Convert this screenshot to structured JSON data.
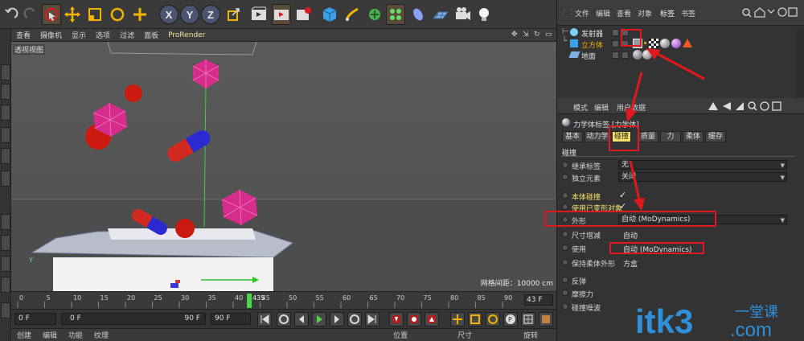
{
  "viewport": {
    "menu": [
      "查看",
      "摄像机",
      "显示",
      "选项",
      "过滤",
      "面板",
      "ProRender"
    ],
    "label": "透视视图",
    "grid_label": "网格间距：10000 cm"
  },
  "timeline": {
    "ticks": [
      "0",
      "5",
      "10",
      "15",
      "20",
      "25",
      "30",
      "35",
      "40",
      "45",
      "50",
      "55",
      "60",
      "65",
      "70",
      "75",
      "80",
      "85",
      "90"
    ],
    "marker": "435",
    "current_frame": "43 F"
  },
  "playback": {
    "start": "0 F",
    "range_start": "0 F",
    "range_end": "90 F",
    "end": "90 F"
  },
  "bottom_bar": {
    "left": [
      "创建",
      "编辑",
      "功能",
      "纹理"
    ],
    "right": [
      "位置",
      "尺寸",
      "旋转"
    ]
  },
  "object_manager": {
    "menu": [
      "文件",
      "编辑",
      "查看",
      "对象",
      "标签",
      "书签"
    ],
    "active_menu": "标签",
    "objects": [
      {
        "name": "发射器"
      },
      {
        "name": "立方体"
      },
      {
        "name": "地面"
      }
    ]
  },
  "attribute_manager": {
    "menu": [
      "模式",
      "编辑",
      "用户数据"
    ],
    "title": "力学体标签 [力学体]",
    "tabs": [
      "基本",
      "动力学",
      "碰撞",
      "质量",
      "力",
      "柔体",
      "缓存"
    ],
    "active_tab": "碰撞",
    "section": "碰撞",
    "rows": [
      {
        "label": "继承标签",
        "value": "无",
        "kind": "dropdown"
      },
      {
        "label": "独立元素",
        "value": "关闭",
        "kind": "dropdown"
      },
      {
        "label": "本体碰撞",
        "value": "✓",
        "kind": "check"
      },
      {
        "label": "使用已变形对象",
        "value": "✓",
        "kind": "check"
      },
      {
        "label": "外形",
        "value": "自动 (MoDynamics)",
        "kind": "dropdown"
      },
      {
        "label": "尺寸增减",
        "value": "自动",
        "kind": "text"
      },
      {
        "label": "使用",
        "value": "自动 (MoDynamics)",
        "kind": "text"
      },
      {
        "label": "保持柔体外形",
        "value": "方盒",
        "kind": "text"
      },
      {
        "label": "反弹",
        "value": "",
        "kind": "text"
      },
      {
        "label": "摩擦力",
        "value": "",
        "kind": "text"
      },
      {
        "label": "碰撞噪波",
        "value": "",
        "kind": "text"
      }
    ]
  },
  "watermark": {
    "brand": "itk3",
    "cn": "一堂课",
    "domain": ".com"
  },
  "colors": {
    "highlight_tab": "#f4e36a",
    "annotation_red": "#e0191e",
    "sphere_red": "#cc1a10",
    "octa_magenta": "#d62c8c",
    "watermark_blue": "#2f8fd8"
  }
}
